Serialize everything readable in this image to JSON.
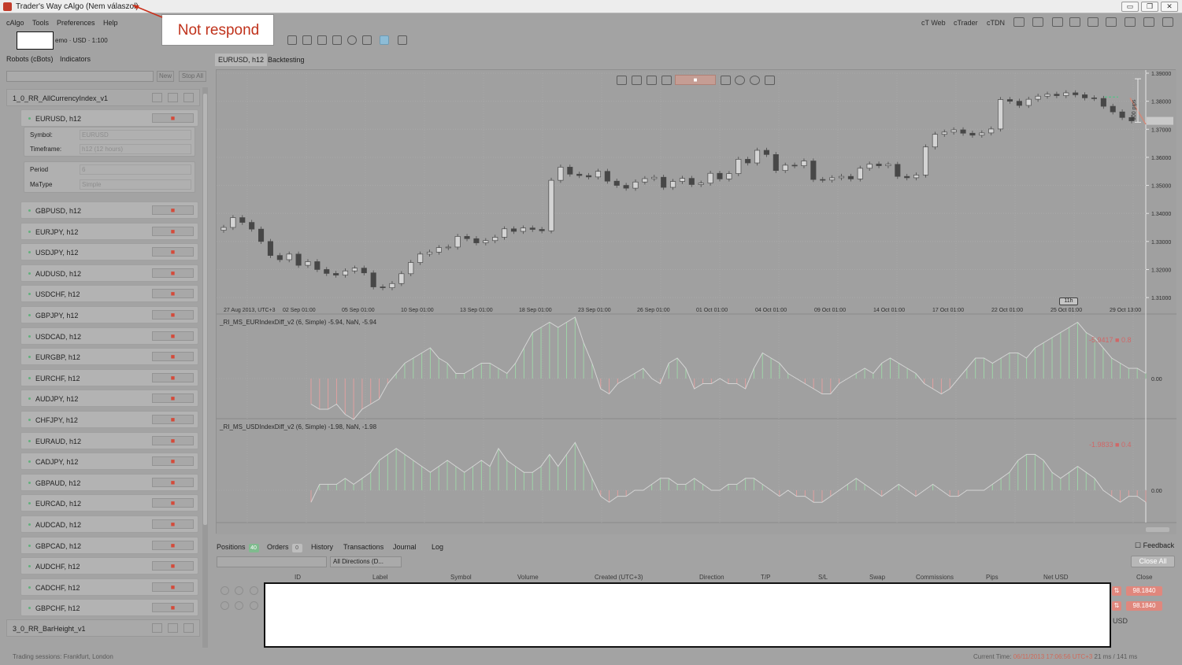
{
  "window": {
    "title": "Trader's Way cAlgo (Nem válaszol)",
    "buttons": [
      "▭",
      "❐",
      "✕"
    ]
  },
  "annotation": {
    "text": "Not respond"
  },
  "menu": {
    "items": [
      "cAlgo",
      "Tools",
      "Preferences",
      "Help"
    ],
    "links": [
      "cT Web",
      "cTrader",
      "cTDN"
    ]
  },
  "account": {
    "text": "emo · USD · 1:100"
  },
  "left_panel": {
    "tabs": [
      "Robots (cBots)",
      "Indicators"
    ],
    "new_label": "New",
    "stop_all_label": "Stop All",
    "groups": [
      {
        "name": "1_0_RR_AllCurrencyIndex_v1"
      },
      {
        "name": "3_0_RR_BarHeight_v1"
      }
    ],
    "expanded_instance": {
      "label": "EURUSD, h12",
      "symbol_label": "Symbol:",
      "symbol_value": "EURUSD",
      "timeframe_label": "Timeframe:",
      "timeframe_value": "h12 (12 hours)",
      "period_label": "Period",
      "period_value": "6",
      "matype_label": "MaType",
      "matype_value": "Simple"
    },
    "instances": [
      "GBPUSD, h12",
      "EURJPY, h12",
      "USDJPY, h12",
      "AUDUSD, h12",
      "USDCHF, h12",
      "GBPJPY, h12",
      "USDCAD, h12",
      "EURGBP, h12",
      "EURCHF, h12",
      "AUDJPY, h12",
      "CHFJPY, h12",
      "EURAUD, h12",
      "CADJPY, h12",
      "GBPAUD, h12",
      "EURCAD, h12",
      "AUDCAD, h12",
      "GBPCAD, h12",
      "AUDCHF, h12",
      "CADCHF, h12",
      "GBPCHF, h12"
    ],
    "stop_glyph": "■"
  },
  "chart_tabs": [
    "EURUSD, h12",
    "Backtesting"
  ],
  "chart_toolbar": {
    "stop_glyph": "■"
  },
  "chart": {
    "pips_label": "100 pips",
    "zoom_badge": "11h",
    "ind1_label": "_RI_MS_EURIndexDiff_v2 (6, Simple) -5.94, NaN, -5.94",
    "ind1_value": "-5.9417 ■ 0.8",
    "ind2_label": "_RI_MS_USDIndexDiff_v2 (6, Simple) -1.98, NaN, -1.98",
    "ind2_value": "-1.9833 ■ 0.4"
  },
  "chart_data": [
    {
      "type": "candlestick",
      "title": "EURUSD, h12",
      "x_ticks": [
        "27 Aug 2013, UTC+3",
        "02 Sep 01:00",
        "05 Sep 01:00",
        "10 Sep 01:00",
        "13 Sep 01:00",
        "18 Sep 01:00",
        "23 Sep 01:00",
        "26 Sep 01:00",
        "01 Oct 01:00",
        "04 Oct 01:00",
        "09 Oct 01:00",
        "14 Oct 01:00",
        "17 Oct 01:00",
        "22 Oct 01:00",
        "25 Oct 01:00",
        "29 Oct 13:00"
      ],
      "y_ticks": [
        "1.39000",
        "1.38000",
        "1.37000",
        "1.36000",
        "1.35000",
        "1.34000",
        "1.33000",
        "1.32000",
        "1.31000"
      ],
      "ylim": [
        1.3075,
        1.39
      ],
      "close": [
        1.335,
        1.3385,
        1.3368,
        1.3344,
        1.33,
        1.325,
        1.3235,
        1.3255,
        1.3215,
        1.3228,
        1.32,
        1.3186,
        1.318,
        1.3195,
        1.3205,
        1.3188,
        1.3138,
        1.3135,
        1.315,
        1.3185,
        1.3225,
        1.3255,
        1.3262,
        1.3278,
        1.328,
        1.3318,
        1.331,
        1.3295,
        1.3303,
        1.3315,
        1.3345,
        1.3336,
        1.3348,
        1.3343,
        1.3338,
        1.3518,
        1.3565,
        1.354,
        1.3535,
        1.353,
        1.355,
        1.3515,
        1.35,
        1.349,
        1.3512,
        1.3524,
        1.3529,
        1.3493,
        1.3514,
        1.3525,
        1.3503,
        1.3508,
        1.3543,
        1.3523,
        1.3542,
        1.3593,
        1.358,
        1.3625,
        1.361,
        1.3553,
        1.3572,
        1.357,
        1.3587,
        1.3521,
        1.3519,
        1.3527,
        1.3532,
        1.3523,
        1.3561,
        1.3576,
        1.357,
        1.3575,
        1.3532,
        1.3527,
        1.3537,
        1.3637,
        1.3682,
        1.369,
        1.3698,
        1.3686,
        1.3679,
        1.3687,
        1.3701,
        1.3806,
        1.38,
        1.3785,
        1.3807,
        1.3818,
        1.3825,
        1.382,
        1.383,
        1.3823,
        1.3812,
        1.381,
        1.3782,
        1.3762,
        1.3742,
        1.373
      ],
      "bull_count": 47,
      "bear_count": 51
    },
    {
      "type": "bar",
      "title": "_RI_MS_EURIndexDiff_v2 (6, Simple) -5.94, NaN, -5.94",
      "y_ticks": [
        "0.00"
      ],
      "values": [
        -5,
        -6,
        -6,
        -5,
        -7,
        -8,
        -6,
        -5,
        -4,
        -1,
        1,
        3,
        4,
        5,
        6,
        4,
        3,
        1,
        1,
        2,
        3,
        3,
        2,
        1,
        3,
        6,
        9,
        10,
        11,
        10,
        11,
        12,
        7,
        3,
        -2,
        -3,
        -1,
        0,
        1,
        2,
        0,
        -1,
        3,
        4,
        2,
        -2,
        -1,
        -1,
        0,
        -1,
        -1,
        -2,
        2,
        5,
        4,
        3,
        1,
        0,
        -1,
        -2,
        -3,
        -3,
        -1,
        0,
        1,
        2,
        1,
        3,
        4,
        3,
        2,
        1,
        -1,
        -2,
        -3,
        -2,
        0,
        2,
        4,
        4,
        3,
        4,
        5,
        5,
        4,
        6,
        7,
        8,
        9,
        10,
        11,
        9,
        8,
        6,
        4,
        3,
        2,
        2,
        1
      ],
      "value_label": "-5.9417 ■ 0.8"
    },
    {
      "type": "bar",
      "title": "_RI_MS_USDIndexDiff_v2 (6, Simple) -1.98, NaN, -1.98",
      "y_ticks": [
        "0.00"
      ],
      "values": [
        -2,
        1,
        1,
        1,
        2,
        1,
        2,
        3,
        5,
        6,
        7,
        6,
        5,
        4,
        3,
        4,
        5,
        4,
        3,
        4,
        5,
        4,
        7,
        5,
        4,
        3,
        3,
        4,
        6,
        4,
        6,
        8,
        5,
        2,
        -1,
        -2,
        -1,
        -1,
        0,
        0,
        1,
        2,
        2,
        1,
        1,
        2,
        1,
        0,
        0,
        1,
        1,
        2,
        2,
        1,
        0,
        -1,
        0,
        -1,
        -1,
        -2,
        -2,
        -1,
        0,
        1,
        2,
        1,
        0,
        -1,
        0,
        1,
        0,
        -1,
        0,
        1,
        0,
        -1,
        -1,
        0,
        0,
        0,
        1,
        2,
        3,
        5,
        6,
        6,
        5,
        3,
        2,
        3,
        4,
        3,
        2,
        0,
        -1,
        -2,
        -1,
        -1,
        -2
      ]
    }
  ],
  "bottom": {
    "tabs": [
      {
        "label": "Positions",
        "badge": "40"
      },
      {
        "label": "Orders",
        "badge": "0"
      },
      {
        "label": "History"
      },
      {
        "label": "Transactions"
      },
      {
        "label": "Journal"
      },
      {
        "label": "Log"
      }
    ],
    "feedback_label": "Feedback",
    "direction_filter": "All Directions (D...",
    "close_all": "Close All",
    "columns": [
      "ID",
      "Label",
      "Symbol",
      "Volume",
      "Created (UTC+3)",
      "Direction",
      "T/P",
      "S/L",
      "Swap",
      "Commissions",
      "Pips",
      "Net USD",
      "Close"
    ],
    "close_prices": [
      "98.1840",
      "98.1840"
    ],
    "usd_label": "USD"
  },
  "status": {
    "sessions": "Trading sessions: Frankfurt, London",
    "time_label": "Current Time:",
    "time_value": "06/11/2013 17:06:56",
    "tz": "UTC+3",
    "latency": "21 ms / 141 ms"
  }
}
